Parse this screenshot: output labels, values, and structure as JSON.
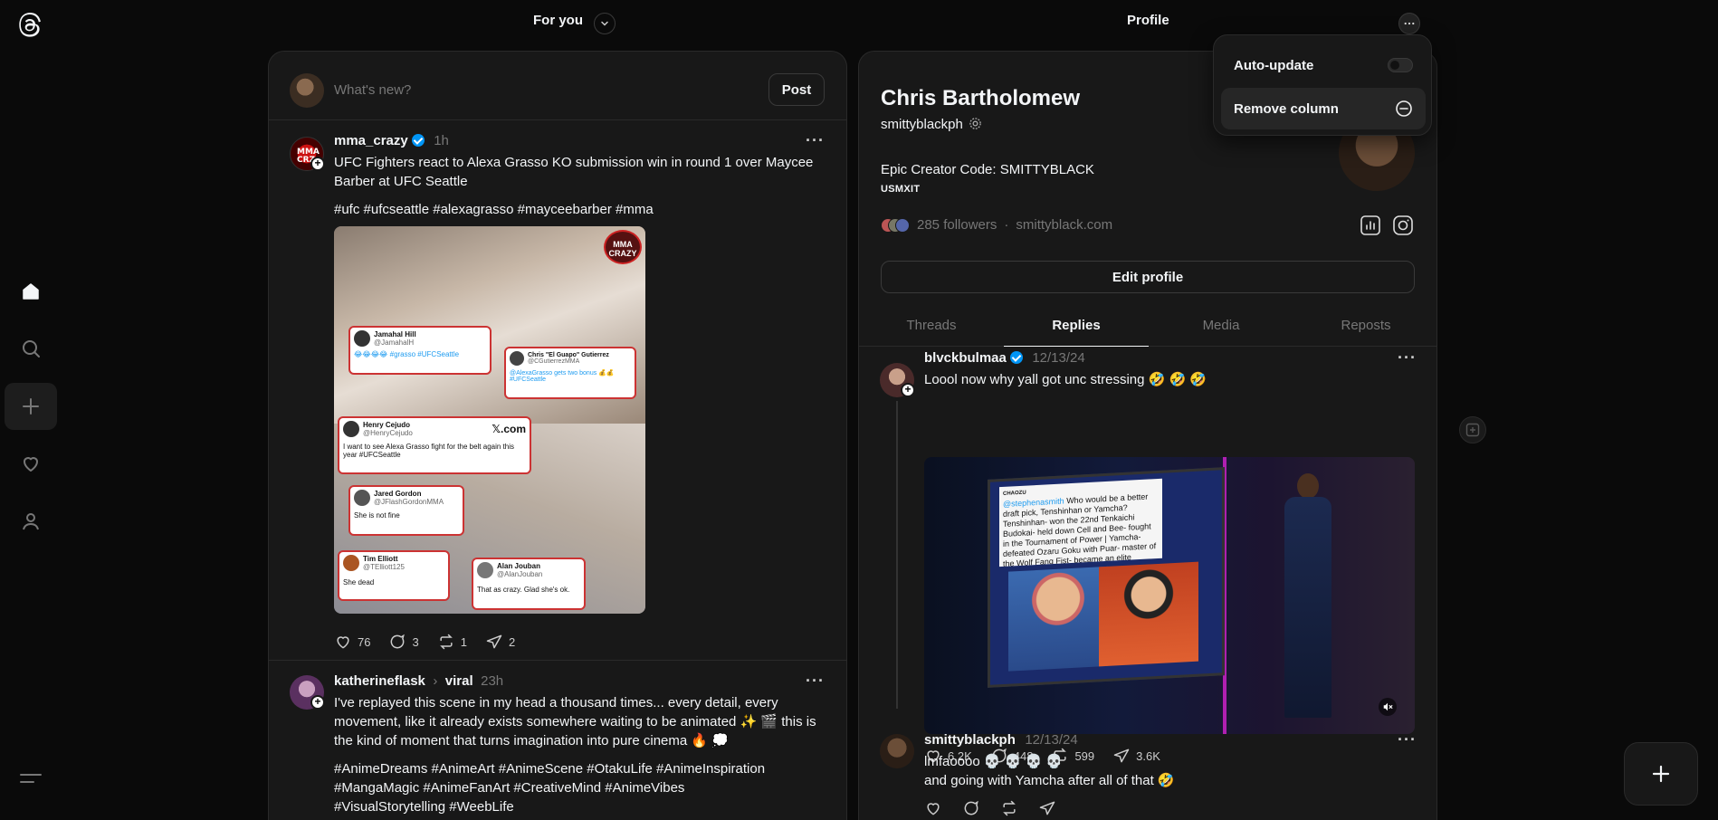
{
  "nav": {
    "icons": [
      "threads-logo-icon",
      "home-icon",
      "search-icon",
      "create-icon",
      "activity-heart-icon",
      "profile-icon",
      "menu-icon"
    ]
  },
  "columns": {
    "feed": {
      "title": "For you",
      "composer": {
        "placeholder": "What's new?",
        "post_label": "Post"
      },
      "posts": [
        {
          "username": "mma_crazy",
          "time": "1h",
          "text": "UFC Fighters react to Alexa Grasso KO submission win in round 1 over Maycee Barber at UFC Seattle",
          "hashtags": "#ufc #ufcseattle #alexagrasso #mayceebarber #mma",
          "likes": "76",
          "replies": "3",
          "reposts": "1",
          "shares": "2",
          "image": {
            "watermark": "MMA CRAZY",
            "tweets": [
              {
                "name": "Jamahal Hill",
                "handle": "@JamahalH",
                "body": "😂😂😂😂 #grasso #UFCSeattle"
              },
              {
                "name": "Chris \"El Guapo\" Gutierrez",
                "handle": "@CGutierrezMMA",
                "body": "@AlexaGrasso gets two bonus 💰💰 #UFCSeattle"
              },
              {
                "name": "Henry Cejudo",
                "handle": "@HenryCejudo",
                "body": "I want to see Alexa Grasso fight for the belt again this year #UFCSeattle"
              },
              {
                "name": "Jared Gordon",
                "handle": "@JFlashGordonMMA",
                "body": "She is not fine"
              },
              {
                "name": "Tim Elliott",
                "handle": "@TElliott125",
                "body": "She dead"
              },
              {
                "name": "Alan Jouban",
                "handle": "@AlanJouban",
                "body": "That as crazy. Glad she's ok."
              }
            ],
            "xcom": "𝕏.com"
          }
        },
        {
          "username": "katherineflask",
          "topic": "viral",
          "time": "23h",
          "text": "I've replayed this scene in my head a thousand times... every detail, every movement, like it already exists somewhere waiting to be animated ✨ 🎬 this is the kind of moment that turns imagination into pure cinema 🔥 💭",
          "hashtags": "#AnimeDreams #AnimeArt #AnimeScene #OtakuLife #AnimeInspiration #MangaMagic #AnimeFanArt #CreativeMind #AnimeVibes #VisualStorytelling #WeebLife"
        }
      ]
    },
    "profile": {
      "title": "Profile",
      "name": "Chris Bartholomew",
      "handle": "smittyblackph",
      "bio": "Epic Creator Code: SMITTYBLACK",
      "bio_sub": "USMXIT",
      "followers": "285 followers",
      "link": "smittyblack.com",
      "edit_label": "Edit profile",
      "tabs": [
        "Threads",
        "Replies",
        "Media",
        "Reposts"
      ],
      "active_tab": "Replies",
      "posts": [
        {
          "username": "blvckbulmaa",
          "time": "12/13/24",
          "text": "Loool now why yall got unc stressing 🤣 🤣 🤣",
          "likes": "6.2K",
          "replies": "448",
          "reposts": "599",
          "shares": "3.6K",
          "screen": {
            "handle": "@stephenasmith",
            "text": "Who would be a better draft pick, Tenshinhan or Yamcha? Tenshinhan- won the 22nd Tenkaichi Budokai- held down Cell and Bee- fought in the Tournament of Power | Yamcha- defeated Ozaru Goku with Puar- master of the Wolf Fang Fist- became an elite baseball player",
            "label": "CHAOZU"
          }
        },
        {
          "username": "smittyblackph",
          "time": "12/13/24",
          "line1": "lmfaoooo 💀 💀 💀 💀",
          "line2": "and going with Yamcha after all of that 🤣"
        }
      ],
      "menu": {
        "auto_update": "Auto-update",
        "remove_column": "Remove column"
      }
    }
  },
  "colors": {
    "bg": "#0a0a0a",
    "card": "#181818",
    "border": "#2a2a2a",
    "muted": "#777777",
    "verified": "#0095f6"
  }
}
